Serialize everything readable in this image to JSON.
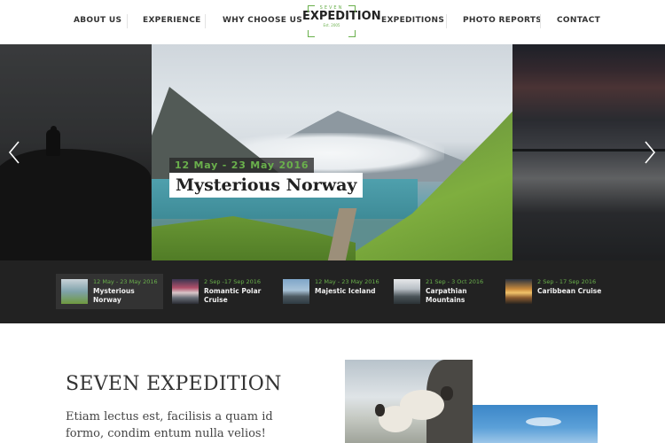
{
  "header": {
    "nav_left": [
      {
        "label": "ABOUT US"
      },
      {
        "label": "EXPERIENCE"
      },
      {
        "label": "WHY CHOOSE US"
      }
    ],
    "nav_right": [
      {
        "label": "EXPEDITIONS"
      },
      {
        "label": "PHOTO REPORTS"
      },
      {
        "label": "CONTACT"
      }
    ],
    "logo": {
      "top": "SEVEN",
      "main": "EXPEDITION",
      "est": "Est. 2005",
      "accent_color": "#6ab04c"
    }
  },
  "hero": {
    "active_slide": {
      "date": "12 May - 23 May 2016",
      "title": "Mysterious Norway"
    },
    "prev_icon": "chevron-left-icon",
    "next_icon": "chevron-right-icon"
  },
  "thumbnails": [
    {
      "date": "12 May - 23 May 2016",
      "title": "Mysterious Norway",
      "active": true
    },
    {
      "date": "2 Sep -17 Sep 2016",
      "title": "Romantic Polar Cruise",
      "active": false
    },
    {
      "date": "12 May - 23 May 2016",
      "title": "Majestic Iceland",
      "active": false
    },
    {
      "date": "21 Sep - 3 Oct 2016",
      "title": "Carpathian Mountains",
      "active": false
    },
    {
      "date": "2 Sep - 17 Sep 2016",
      "title": "Caribbean Cruise",
      "active": false
    }
  ],
  "about": {
    "title": "SEVEN EXPEDITION",
    "text": "Etiam lectus est, facilisis a quam id formo, condim entum nulla velios!"
  },
  "colors": {
    "accent": "#6ab04c",
    "strip_bg": "#222222"
  }
}
